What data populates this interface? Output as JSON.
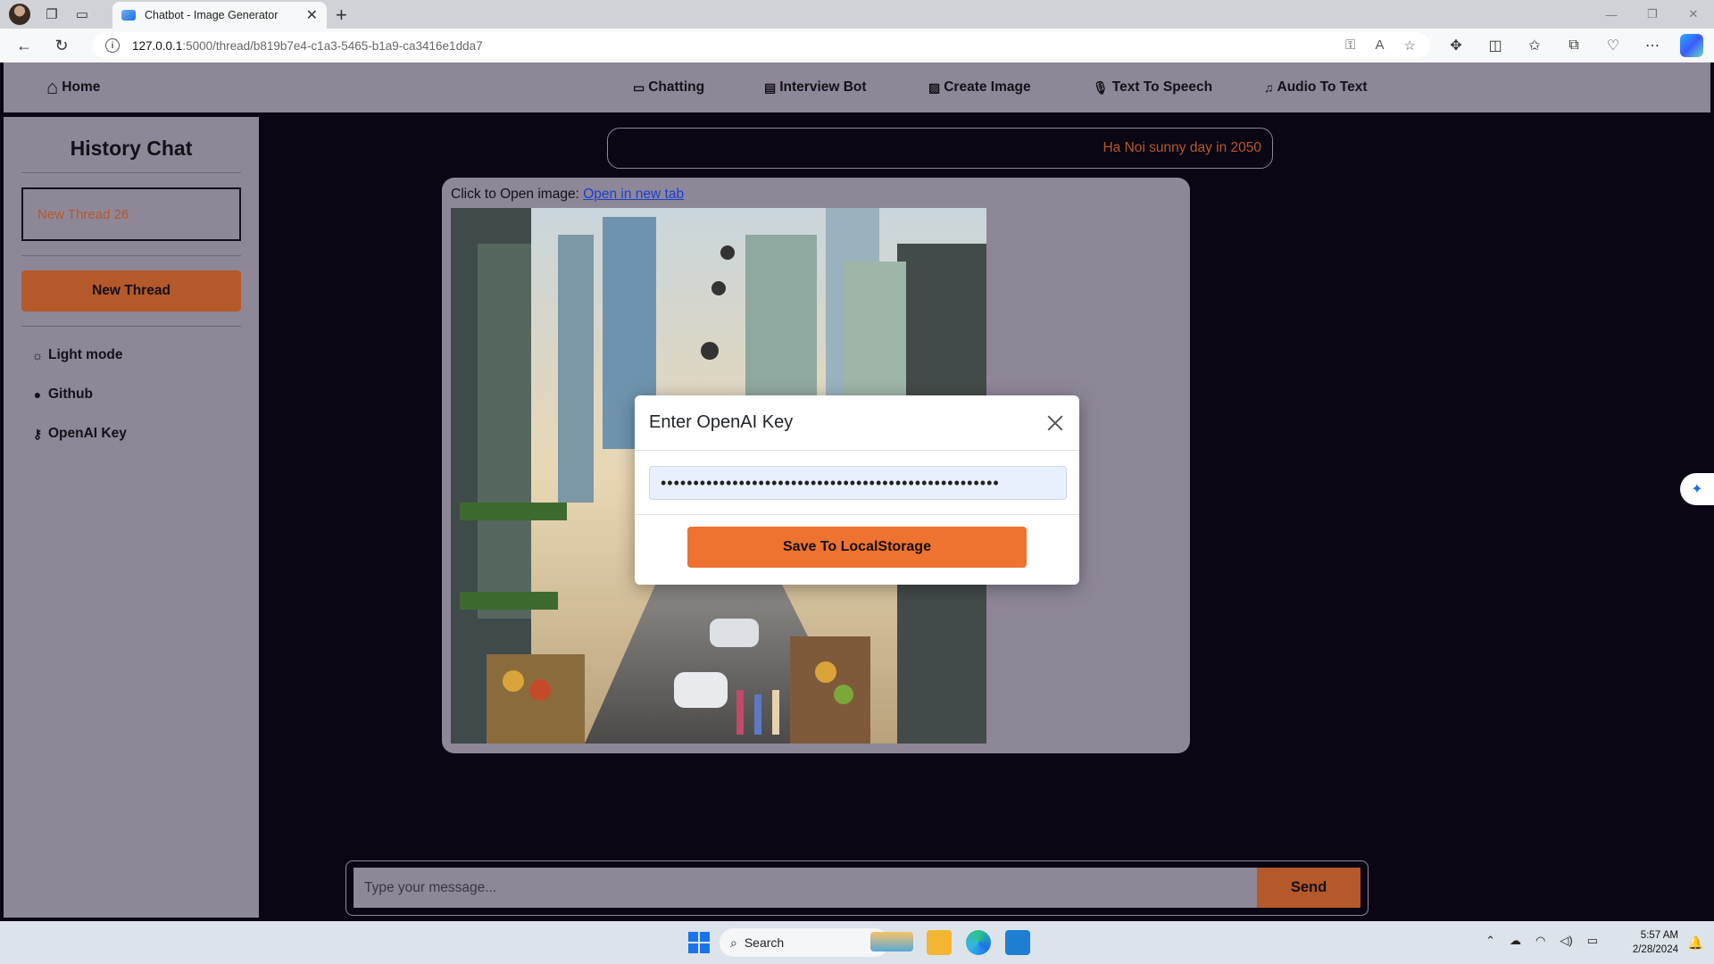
{
  "browser": {
    "tab_title": "Chatbot - Image Generator",
    "url_host": "127.0.0.1",
    "url_path": ":5000/thread/b819b7e4-c1a3-5465-b1a9-ca3416e1dda7"
  },
  "topnav": {
    "home": "Home",
    "chatting": "Chatting",
    "interview_bot": "Interview Bot",
    "create_image": "Create Image",
    "text_to_speech": "Text To Speech",
    "audio_to_text": "Audio To Text"
  },
  "sidebar": {
    "title": "History Chat",
    "threads": [
      "New Thread 26"
    ],
    "new_thread_button": "New Thread",
    "links": {
      "light_mode": "Light mode",
      "github": "Github",
      "openai_key": "OpenAI Key"
    }
  },
  "chat": {
    "user_prompt": "Ha Noi sunny day in 2050",
    "image_caption_prefix": "Click to Open image: ",
    "image_link_text": "Open in new tab",
    "input_placeholder": "Type your message...",
    "send_button": "Send"
  },
  "modal": {
    "title": "Enter OpenAI Key",
    "key_value": "••••••••••••••••••••••••••••••••••••••••••••••••••••",
    "save_button": "Save To LocalStorage"
  },
  "taskbar": {
    "search_label": "Search",
    "time": "5:57 AM",
    "date": "2/28/2024"
  },
  "colors": {
    "page_bg": "#0a0614",
    "panel": "#8e8798",
    "accent": "#b5582a",
    "save_button": "#ee7230",
    "link": "#1a3fcf"
  }
}
